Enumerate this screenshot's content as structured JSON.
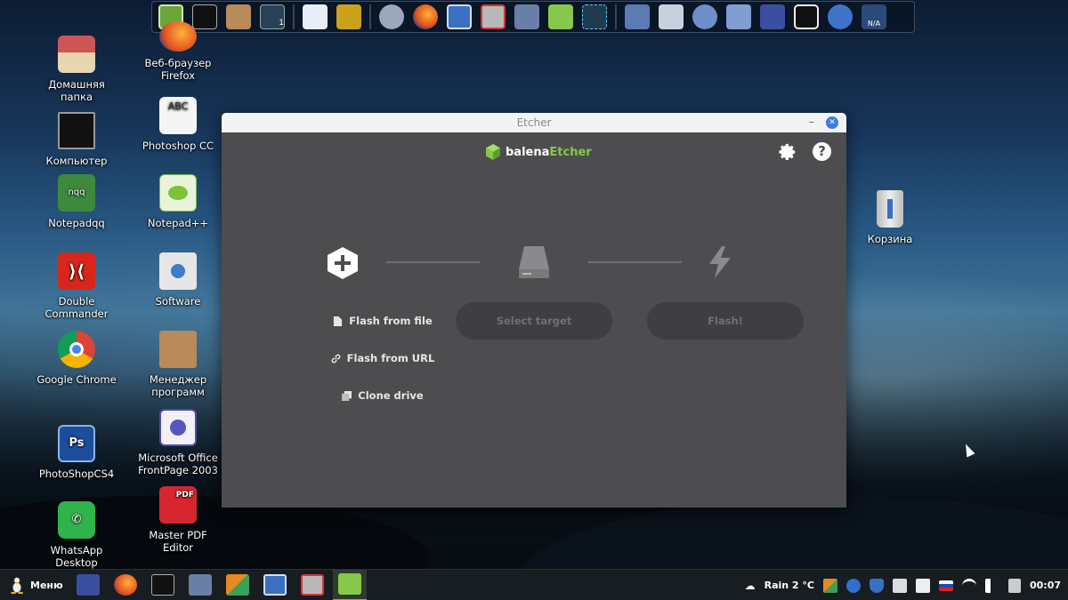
{
  "desktop": {
    "icons_left": [
      {
        "label": "Домашняя папка"
      },
      {
        "label": "Компьютер"
      },
      {
        "label": "Notepadqq"
      },
      {
        "label": "Double\nCommander"
      },
      {
        "label": "Google Chrome"
      },
      {
        "label": "PhotoShopCS4"
      },
      {
        "label": "WhatsApp\nDesktop"
      }
    ],
    "icons_mid": [
      {
        "label": "Веб-браузер\nFirefox"
      },
      {
        "label": "Photoshop CC"
      },
      {
        "label": "Notepad++"
      },
      {
        "label": "Software"
      },
      {
        "label": "Менеджер\nпрограмм"
      },
      {
        "label": "Microsoft Office\nFrontPage 2003"
      },
      {
        "label": "Master PDF Editor"
      }
    ],
    "icons_right": [
      {
        "label": "Корзина"
      }
    ],
    "icon_badges": {
      "notepadqq": "nqq",
      "abc": "ABC",
      "ps": "Ps",
      "pdf": "PDF"
    }
  },
  "top_dock": {
    "items": [
      "mint-menu-icon",
      "terminal-icon",
      "package-icon",
      "workspace-switcher-icon",
      "document-viewer-icon",
      "image-viewer-icon",
      "thunderbird-icon",
      "firefox-icon",
      "system-monitor-icon",
      "backup-icon",
      "folder-icon",
      "etcher-icon",
      "network-icon",
      "home-folder-icon",
      "files-icon",
      "history-icon",
      "downloads-icon",
      "display-icon",
      "power-icon",
      "accessibility-icon",
      "battery-icon"
    ],
    "workspace_number": "1",
    "battery_label": "N/A"
  },
  "etcher": {
    "window_title": "Etcher",
    "minimize_glyph": "–",
    "close_glyph": "✕",
    "brand_part1": "balena",
    "brand_part2": "Etcher",
    "help_glyph": "?",
    "sources": [
      {
        "label": "Flash from file",
        "icon": "file-icon"
      },
      {
        "label": "Flash from URL",
        "icon": "link-icon"
      },
      {
        "label": "Clone drive",
        "icon": "copy-icon"
      }
    ],
    "select_target_label": "Select target",
    "flash_label": "Flash!",
    "colors": {
      "bg": "#4d4d50",
      "accent": "#85c84a",
      "pill": "#3f3f42"
    }
  },
  "panel": {
    "menu_label": "Меню",
    "weather": "Rain 2 °C",
    "clock": "00:07"
  }
}
